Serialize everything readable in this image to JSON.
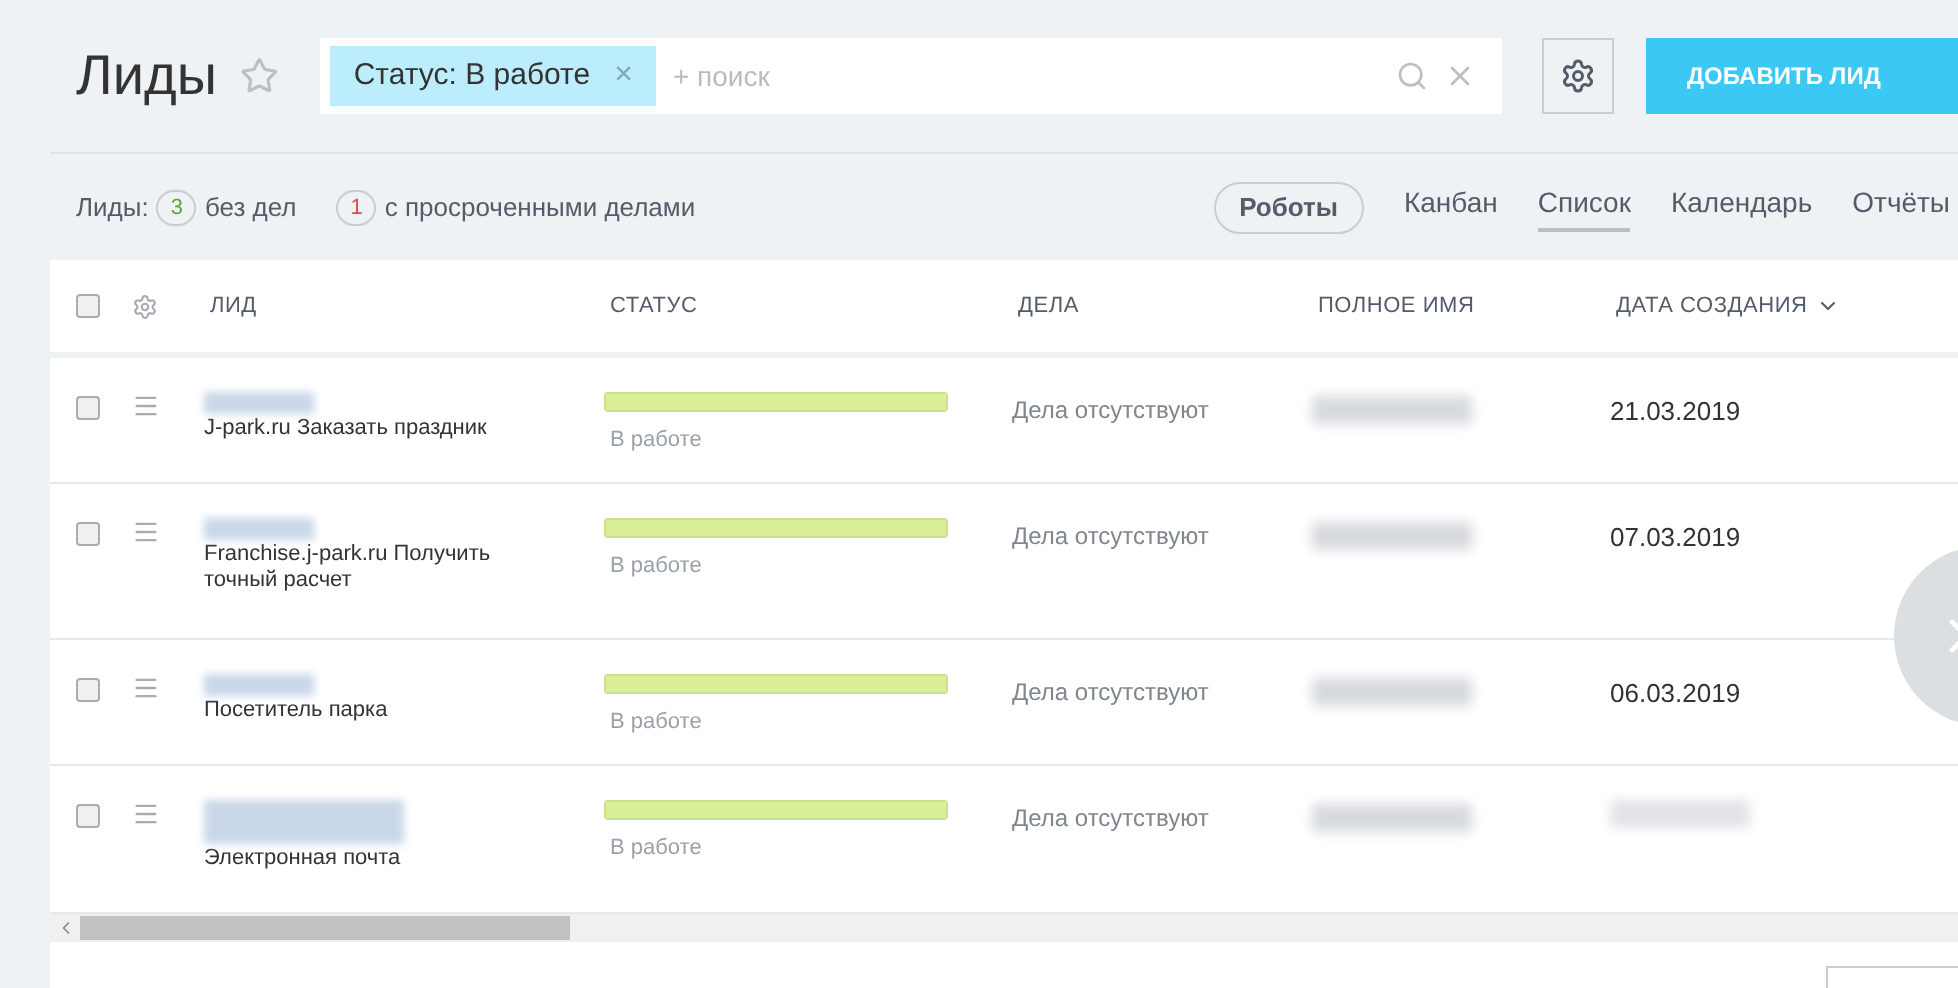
{
  "header": {
    "title": "Лиды",
    "favorite": false,
    "filter_chip": "Статус: В работе",
    "chip_close": "×",
    "search_placeholder": "+ поиск",
    "add_button": "ДОБАВИТЬ ЛИД"
  },
  "counters": [
    {
      "label": "Лиды:",
      "count": "3",
      "text": "без дел",
      "color": "#55a533"
    },
    {
      "count": "1",
      "text": "с просроченными делами",
      "color": "#d94f4f"
    }
  ],
  "robots_button": "Роботы",
  "views": [
    {
      "label": "Канбан",
      "selected": false
    },
    {
      "label": "Список",
      "selected": true
    },
    {
      "label": "Календарь",
      "selected": false
    },
    {
      "label": "Отчёты",
      "selected": false
    }
  ],
  "table": {
    "select_all_checked": false,
    "columns": [
      "ЛИД",
      "СТАТУС",
      "ДЕЛА",
      "ПОЛНОЕ ИМЯ",
      "ДАТА СОЗДАНИЯ"
    ],
    "rows": [
      {
        "checked": false,
        "source": "J-park.ru Заказать праздник",
        "status": "В работе",
        "level": 1,
        "deals": "Дела отсутствуют",
        "date": "21.03.2019"
      },
      {
        "checked": false,
        "source": "Franchise.j-park.ru Получить точный расчет",
        "status": "В работе",
        "level": 1,
        "deals": "Дела отсутствуют",
        "date": "07.03.2019"
      },
      {
        "checked": false,
        "source": "Посетитель парка",
        "status": "В работе",
        "level": 1,
        "deals": "Дела отсутствуют",
        "date": "06.03.2019"
      },
      {
        "checked": false,
        "source": "Электронная почта",
        "status": "В работе",
        "level": 1,
        "deals": "Дела отсутствуют"
      }
    ]
  }
}
